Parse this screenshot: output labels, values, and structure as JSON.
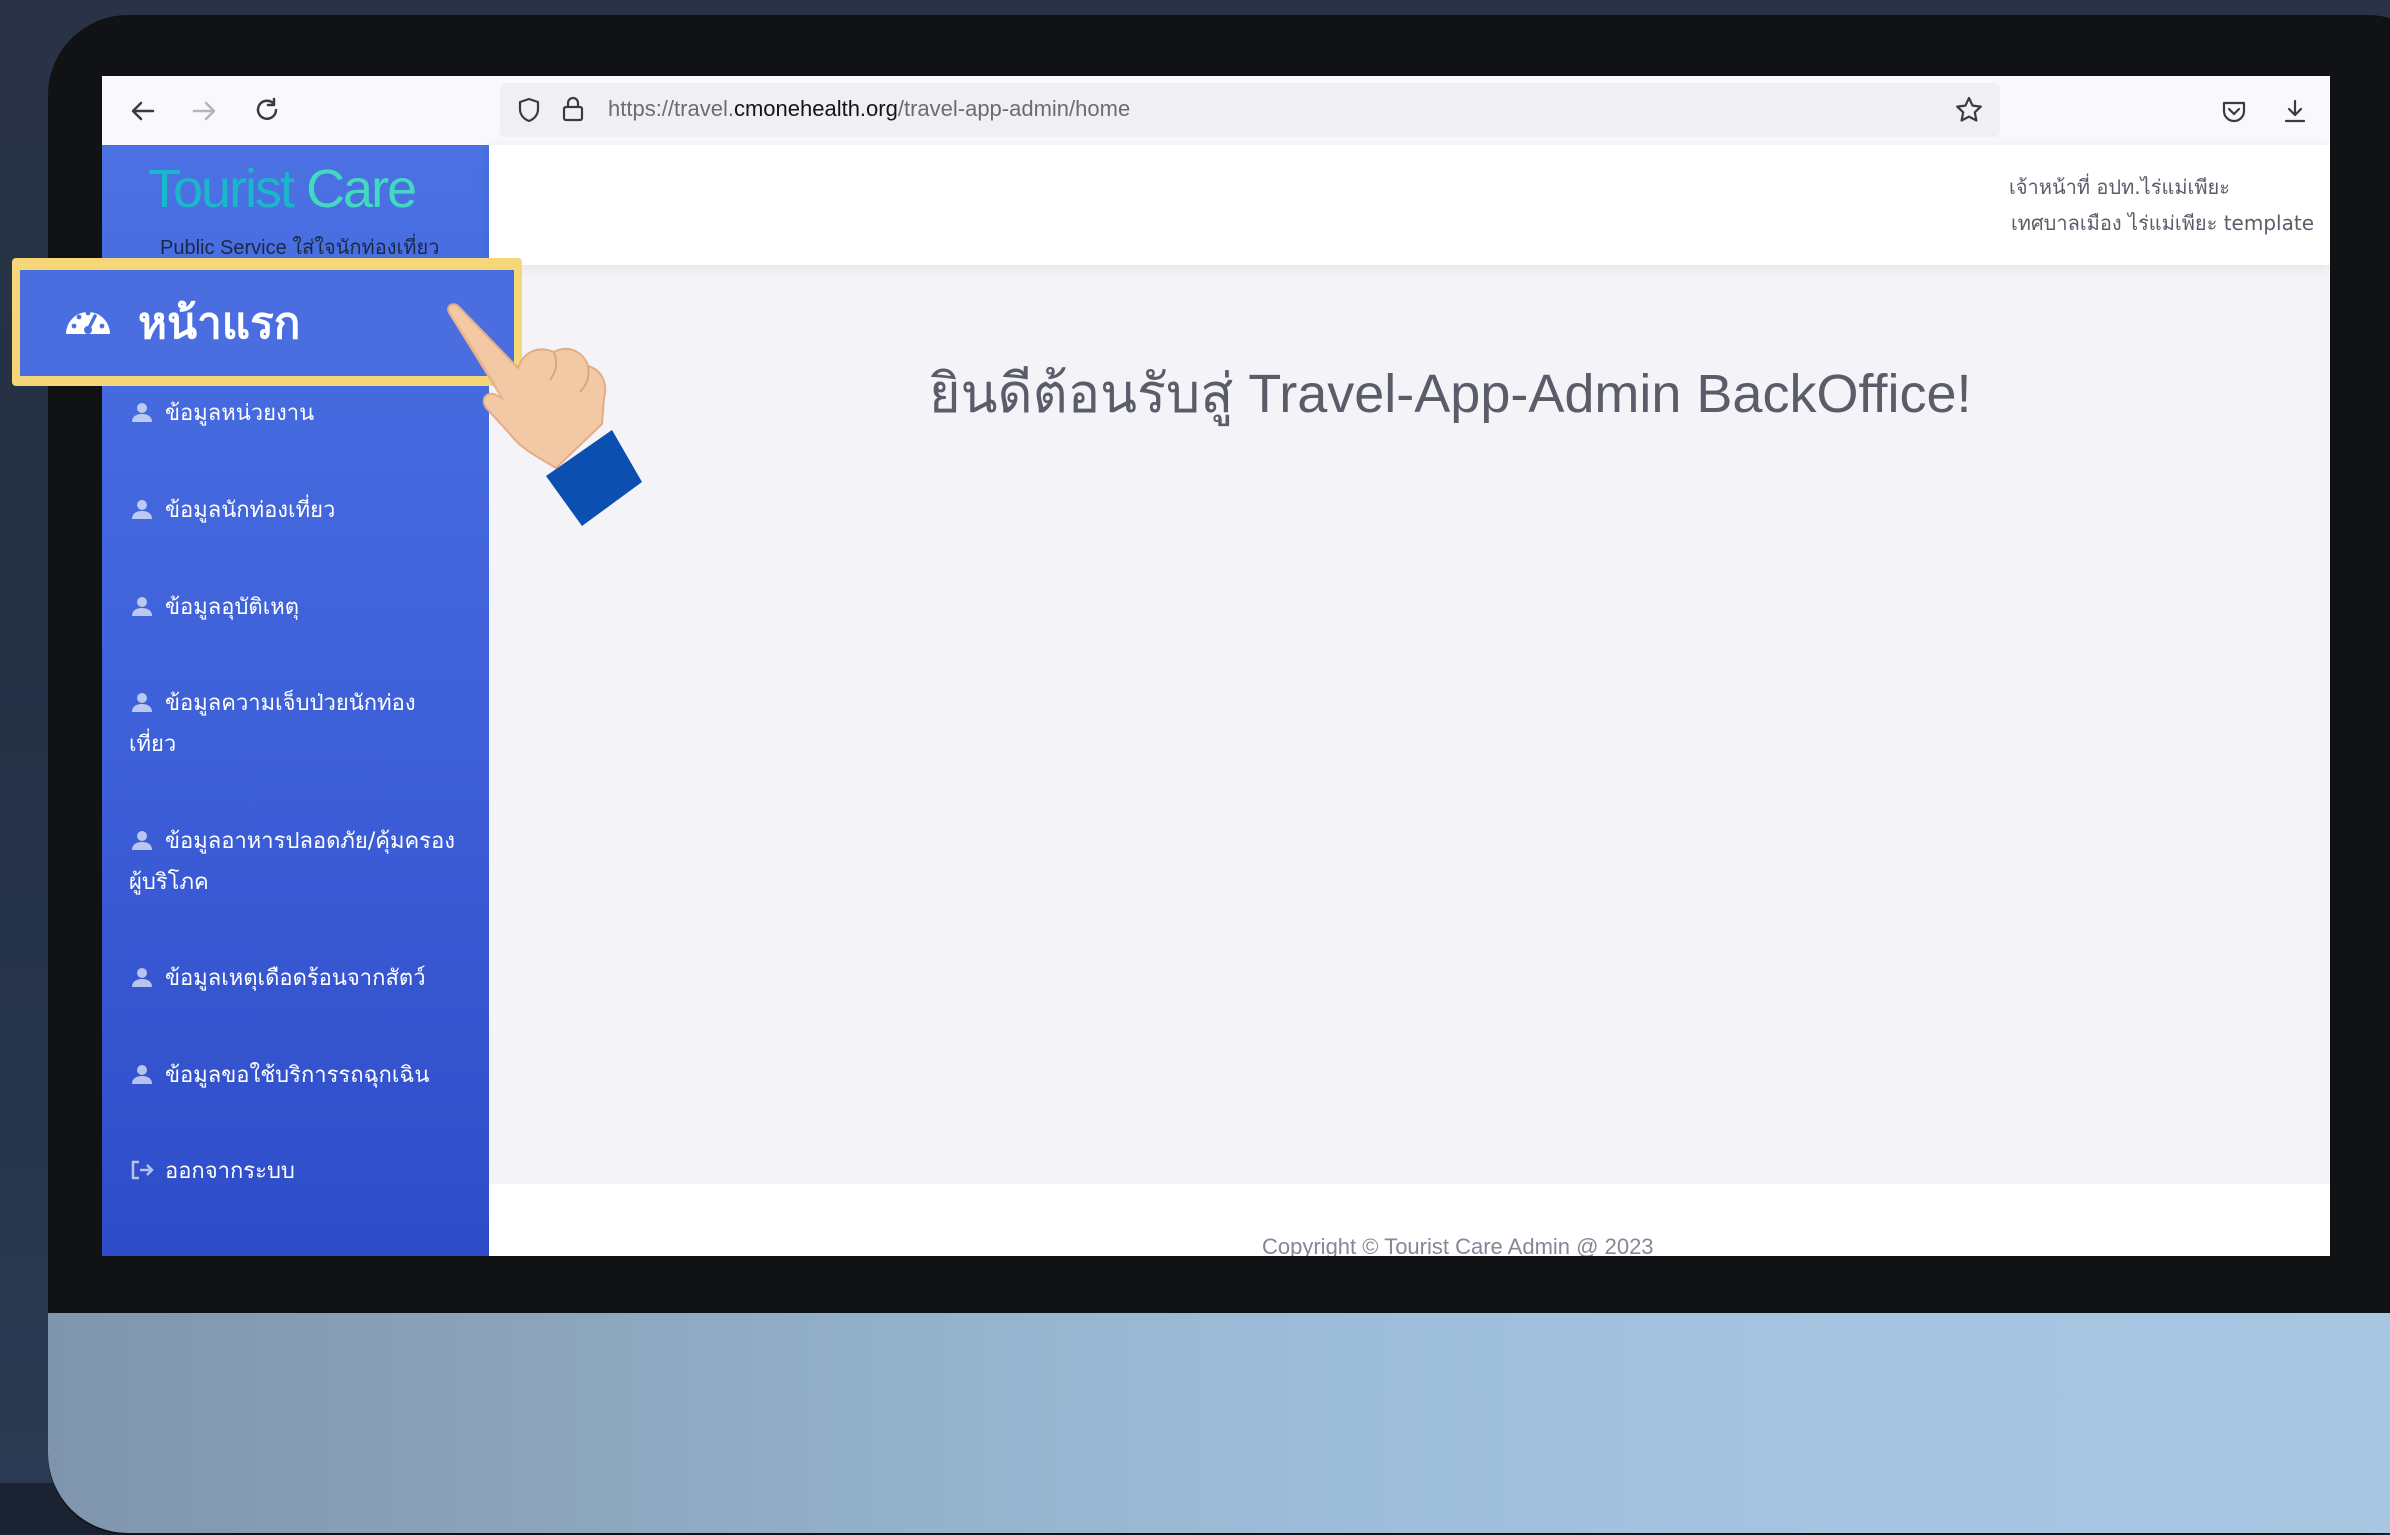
{
  "browser": {
    "url_prefix": "https://travel.",
    "url_domain": "cmonehealth.org",
    "url_path": "/travel-app-admin/home",
    "icons": [
      "back-arrow-icon",
      "forward-arrow-icon",
      "reload-icon",
      "shield-icon",
      "lock-icon",
      "bookmark-star-icon",
      "pocket-icon",
      "download-icon"
    ]
  },
  "logo": {
    "title_a": "Tourist ",
    "title_b": "Care",
    "subtitle": "Public Service ใส่ใจนักท่องเที่ยว"
  },
  "header": {
    "user_name": "เจ้าหน้าที่ อปท.ไร่แม่เพียะ",
    "organization": "เทศบาลเมือง ไร่แม่เพียะ template"
  },
  "callout": {
    "label": "หน้าแรก",
    "icon": "dashboard-gauge-icon",
    "highlight_color": "#f5d779"
  },
  "sidebar": {
    "items": [
      {
        "label": "ข้อมูลหน่วยงาน",
        "icon": "user-icon"
      },
      {
        "label": "ข้อมูลนักท่องเที่ยว",
        "icon": "user-icon"
      },
      {
        "label": "ข้อมูลอุบัติเหตุ",
        "icon": "user-icon"
      },
      {
        "label": "ข้อมูลความเจ็บป่วยนักท่องเที่ยว",
        "icon": "user-icon"
      },
      {
        "label": "ข้อมูลอาหารปลอดภัย/คุ้มครองผู้บริโภค",
        "icon": "user-icon"
      },
      {
        "label": "ข้อมูลเหตุเดือดร้อนจากสัตว์",
        "icon": "user-icon"
      },
      {
        "label": "ข้อมูลขอใช้บริการรถฉุกเฉิน",
        "icon": "user-icon"
      },
      {
        "label": "ออกจากระบบ",
        "icon": "logout-icon"
      }
    ],
    "collapse_icon": "chevron-left-icon"
  },
  "main": {
    "welcome": "ยินดีต้อนรับสู่ Travel-App-Admin BackOffice!"
  },
  "footer": {
    "copyright": "Copyright © Tourist Care Admin @ 2023"
  },
  "colors": {
    "sidebar_top": "#4b71e3",
    "sidebar_bottom": "#2e4cc8",
    "logo_teal": "#19b7c9"
  }
}
